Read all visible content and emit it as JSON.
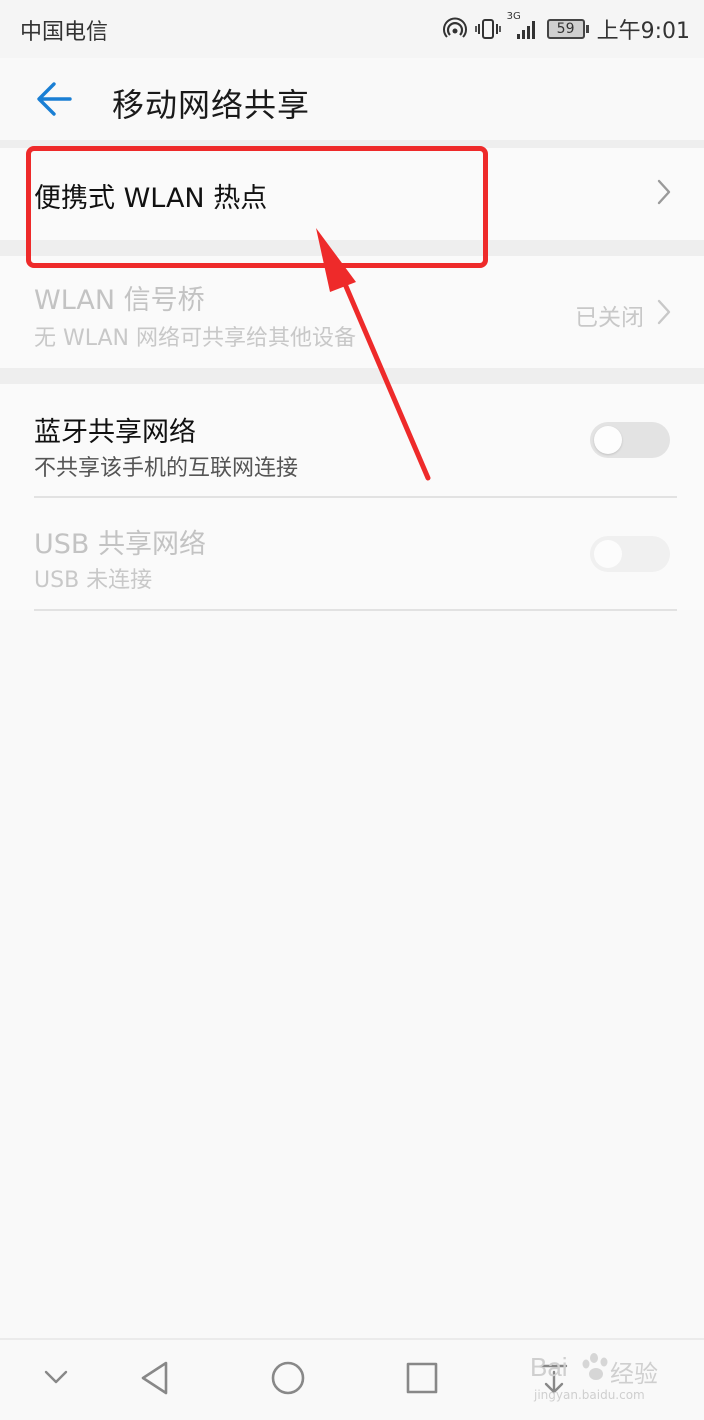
{
  "status_bar": {
    "carrier": "中国电信",
    "network": "3G",
    "battery": "59",
    "time": "上午9:01"
  },
  "header": {
    "title": "移动网络共享"
  },
  "items": [
    {
      "title": "便携式 WLAN 热点",
      "subtitle": "",
      "control": "chevron",
      "enabled": true
    },
    {
      "title": "WLAN 信号桥",
      "subtitle": "无 WLAN 网络可共享给其他设备",
      "status": "已关闭",
      "control": "chevron",
      "enabled": false
    },
    {
      "title": "蓝牙共享网络",
      "subtitle": "不共享该手机的互联网连接",
      "control": "toggle",
      "toggle_on": false,
      "enabled": true
    },
    {
      "title": "USB 共享网络",
      "subtitle": "USB 未连接",
      "control": "toggle",
      "toggle_on": false,
      "enabled": false
    }
  ],
  "annotation": {
    "highlight_color": "#ee2a2a"
  },
  "nav_bar": {
    "icons": [
      "chevron-down-icon",
      "back-triangle-icon",
      "home-circle-icon",
      "recents-square-icon",
      "notification-pull-icon"
    ]
  },
  "watermark": {
    "brand": "Bai",
    "text": "经验",
    "url": "jingyan.baidu.com"
  },
  "colors": {
    "accent": "#1a7fd4",
    "highlight": "#ee2a2a",
    "disabled_text": "#c3c3c3"
  }
}
